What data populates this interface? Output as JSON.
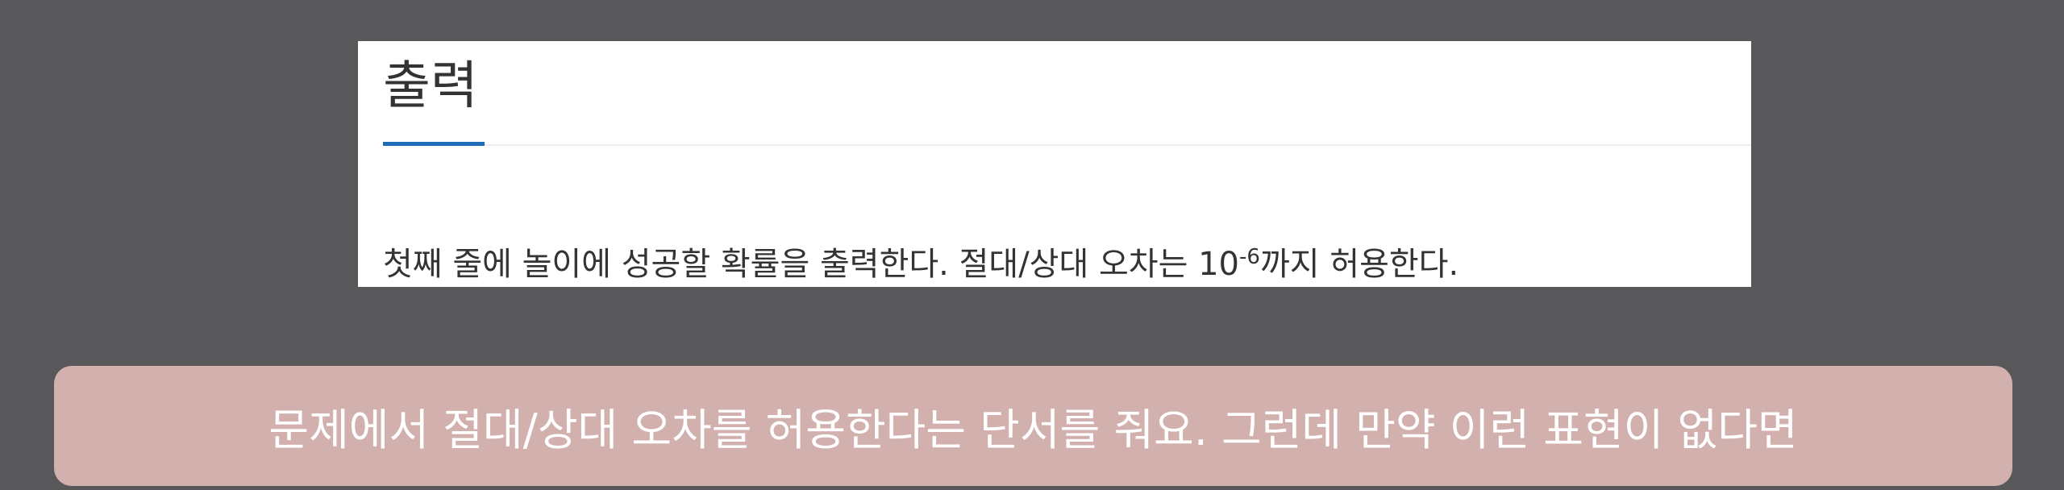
{
  "section": {
    "title": "출력",
    "accent_color": "#1f6bb6",
    "description": {
      "before": "첫째 줄에 놀이에 성공할 확률을 출력한다. 절대/상대 오차는 10",
      "exponent": "-6",
      "after": "까지 허용한다."
    }
  },
  "subtitle": {
    "text": "문제에서 절대/상대 오차를 허용한다는 단서를 줘요. 그런데 만약 이런 표현이 없다면"
  }
}
